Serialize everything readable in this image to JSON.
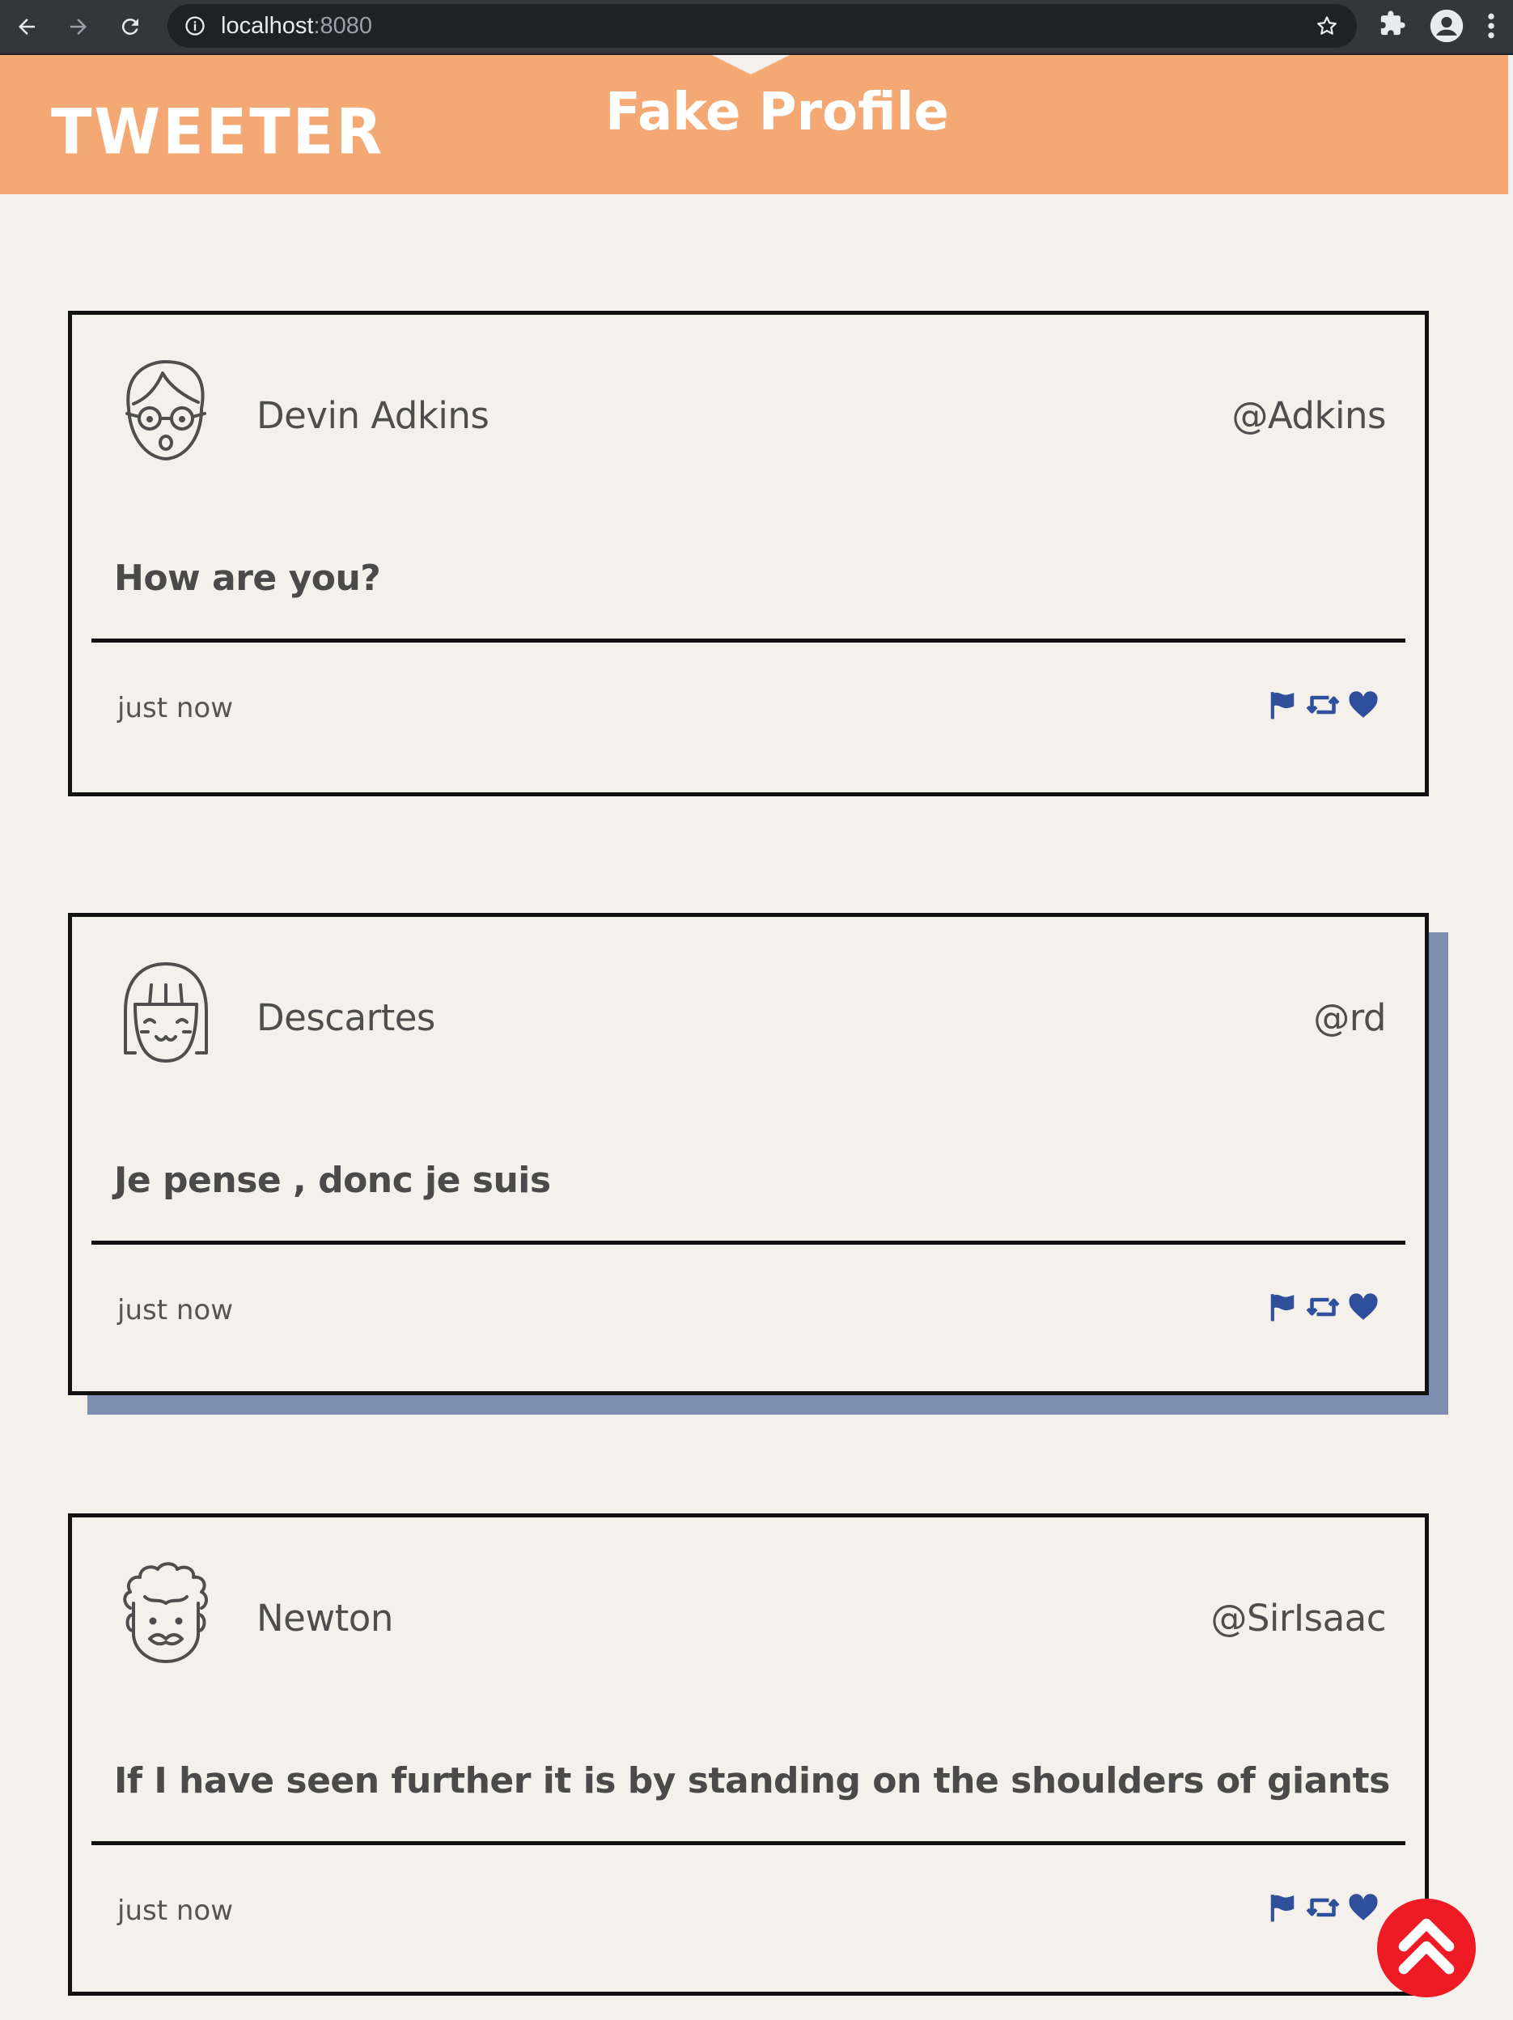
{
  "browser": {
    "url_host": "localhost",
    "url_port": ":8080"
  },
  "header": {
    "logo": "TWEETER",
    "title": "Fake Profile"
  },
  "tweets": [
    {
      "name": "Devin Adkins",
      "handle": "@Adkins",
      "text": "How are you?",
      "time": "just now",
      "avatar": "nerd-glasses-avatar-icon"
    },
    {
      "name": "Descartes",
      "handle": "@rd",
      "text": "Je pense , donc je suis",
      "time": "just now",
      "avatar": "bangs-girl-avatar-icon"
    },
    {
      "name": "Newton",
      "handle": "@SirIsaac",
      "text": "If I have seen further it is by standing on the shoulders of giants",
      "time": "just now",
      "avatar": "curly-hair-avatar-icon"
    }
  ],
  "colors": {
    "header_bg": "#f4a975",
    "action_icons": "#2f4f9a",
    "hover_shadow": "#7c8faf",
    "scroll_top": "#ee1b24"
  }
}
